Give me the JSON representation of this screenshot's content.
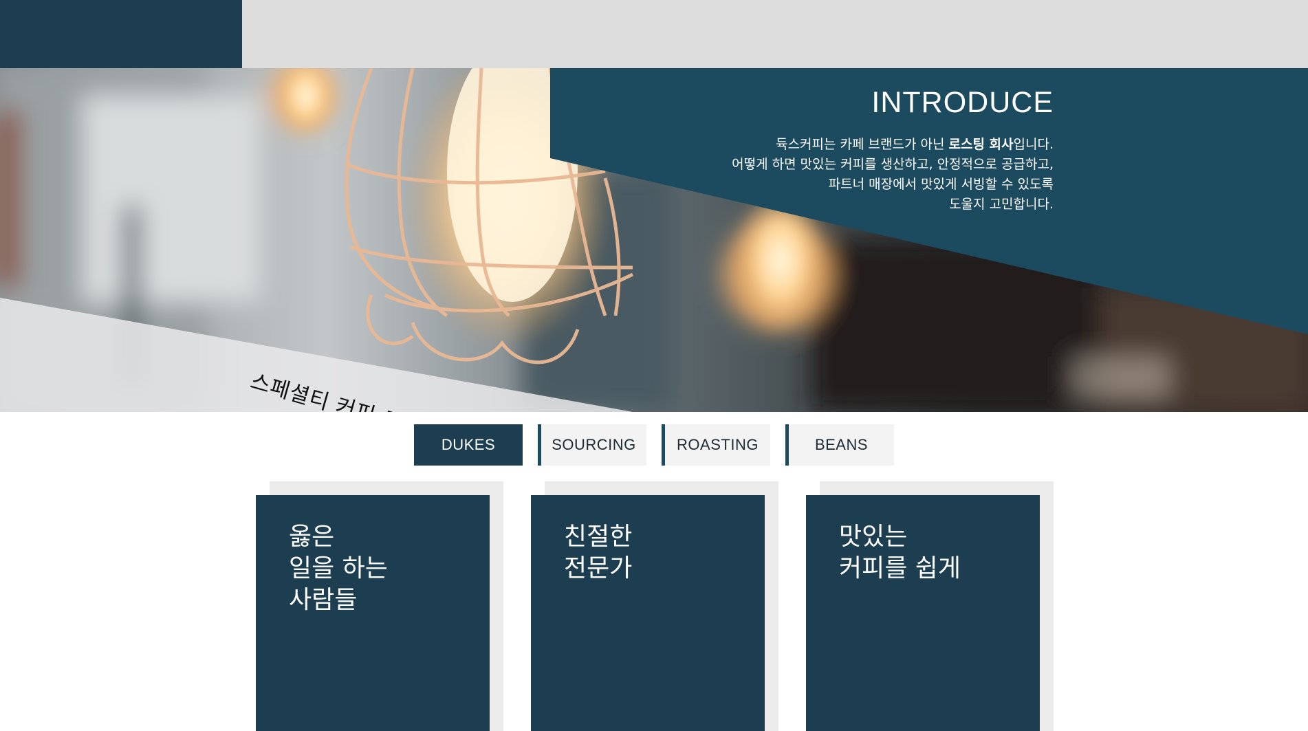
{
  "colors": {
    "brand_dark": "#1c3e50",
    "top_bar": "#dcdcdd",
    "card_shadow": "#ebebeb",
    "tab_inactive_bg": "#f3f3f3"
  },
  "intro": {
    "title": "INTRODUCE",
    "line1_pre": "듁스커피는 카페 브랜드가 아닌 ",
    "line1_bold": "로스팅 회사",
    "line1_post": "입니다.",
    "line2": "어떻게 하면 맛있는 커피를 생산하고, 안정적으로 공급하고,",
    "line3": "파트너 매장에서 맛있게 서빙할 수 있도록",
    "line4": "도울지 고민합니다."
  },
  "hero": {
    "tagline": "스페셜티 커피 로스팅 컴퍼니",
    "background_image": "blurred-cafe-edison-bulbs-photo"
  },
  "tabs": [
    {
      "label": "DUKES",
      "active": true
    },
    {
      "label": "SOURCING",
      "active": false
    },
    {
      "label": "ROASTING",
      "active": false
    },
    {
      "label": "BEANS",
      "active": false
    }
  ],
  "cards": [
    {
      "lines": [
        "옳은",
        "일을 하는",
        "사람들"
      ]
    },
    {
      "lines": [
        "친절한",
        "전문가"
      ]
    },
    {
      "lines": [
        "맛있는",
        "커피를 쉽게"
      ]
    }
  ]
}
